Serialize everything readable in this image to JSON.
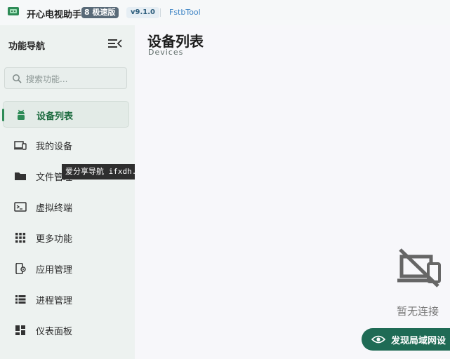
{
  "titlebar": {
    "app_title": "开心电视助手",
    "badge": "极速版",
    "version": "v9.1.0",
    "tool_link": "FstbTool"
  },
  "sidebar": {
    "title": "功能导航",
    "search_placeholder": "搜索功能...",
    "items": [
      {
        "label": "设备列表",
        "icon": "android-icon",
        "active": true
      },
      {
        "label": "我的设备",
        "icon": "devices-icon"
      },
      {
        "label": "文件管理",
        "icon": "folder-icon"
      },
      {
        "label": "虚拟终端",
        "icon": "terminal-icon"
      },
      {
        "label": "更多功能",
        "icon": "grid-icon"
      },
      {
        "label": "应用管理",
        "icon": "app-settings-icon"
      },
      {
        "label": "进程管理",
        "icon": "list-icon"
      },
      {
        "label": "仪表面板",
        "icon": "dashboard-icon"
      }
    ]
  },
  "watermark": "爱分享导航 ifxdh.com",
  "main": {
    "title": "设备列表",
    "subtitle": "Devices",
    "empty_text": "暂无连接",
    "discover_label": "发现局域网设"
  },
  "colors": {
    "accent": "#2e8b57",
    "discover_button": "#1f6b55",
    "link": "#3b82c4"
  }
}
